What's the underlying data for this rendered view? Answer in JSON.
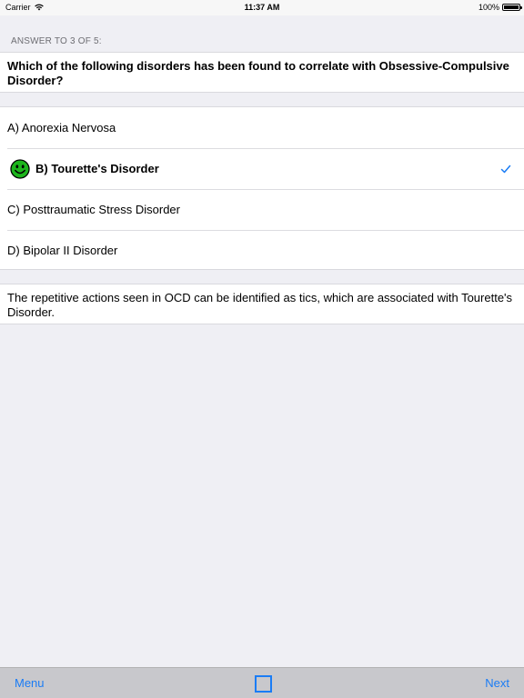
{
  "status_bar": {
    "carrier": "Carrier",
    "time": "11:37 AM",
    "battery": "100%"
  },
  "section_header": "ANSWER TO 3 OF 5:",
  "question": "Which of the following disorders has been found to correlate with Obsessive-Compulsive Disorder?",
  "answers": [
    {
      "label": "A) Anorexia Nervosa"
    },
    {
      "label": "B) Tourette's Disorder",
      "correct": true
    },
    {
      "label": "C) Posttraumatic Stress Disorder"
    },
    {
      "label": "D) Bipolar II Disorder"
    }
  ],
  "explanation": "The repetitive actions seen in OCD can be identified as tics, which are associated with Tourette's Disorder.",
  "toolbar": {
    "menu_label": "Menu",
    "next_label": "Next"
  },
  "colors": {
    "accent": "#1a7cf5",
    "smiley_green": "#1db51d",
    "background": "#efeff4",
    "toolbar": "#c8c8cc"
  },
  "icons": {
    "smiley": "smiley-face-icon",
    "check": "checkmark-icon",
    "square": "square-outline-icon",
    "wifi": "wifi-icon",
    "battery": "battery-icon"
  }
}
